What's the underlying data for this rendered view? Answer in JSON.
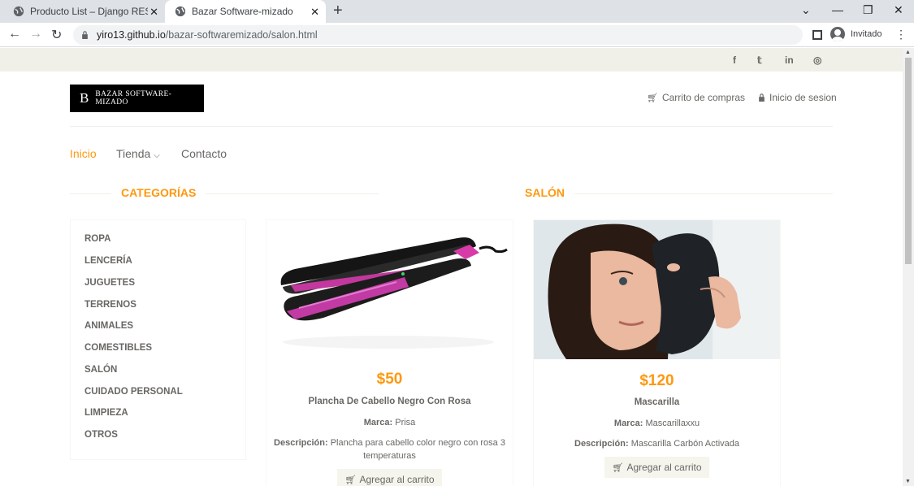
{
  "browser": {
    "tabs": [
      {
        "title": "Producto List – Django REST fran",
        "close": "✕"
      },
      {
        "title": "Bazar Software-mizado",
        "close": "✕"
      }
    ],
    "new_tab": "+",
    "url_host": "yiro13.github.io",
    "url_path": "/bazar-softwaremizado/salon.html",
    "profile": "Invitado",
    "window_controls": {
      "minimize": "—",
      "restore": "❐",
      "close": "✕",
      "tablist": "⌄"
    }
  },
  "social": [
    "f",
    "𝕥",
    "in",
    "◎"
  ],
  "logo": {
    "mark": "B",
    "text": "BAZAR SOFTWARE-MIZADO"
  },
  "header": {
    "cart": "Carrito de compras",
    "login": "Inicio de sesion"
  },
  "nav": {
    "home": "Inicio",
    "shop": "Tienda",
    "contact": "Contacto"
  },
  "sections": {
    "categories": "CATEGORÍAS",
    "salon": "SALÓN"
  },
  "categories": [
    "ROPA",
    "LENCERÍA",
    "JUGUETES",
    "TERRENOS",
    "ANIMALES",
    "COMESTIBLES",
    "SALÓN",
    "CUIDADO PERSONAL",
    "LIMPIEZA",
    "OTROS"
  ],
  "products": [
    {
      "price": "$50",
      "name": "Plancha De Cabello Negro Con Rosa",
      "brand_label": "Marca:",
      "brand": "Prisa",
      "desc_label": "Descripción:",
      "desc": "Plancha para cabello color negro con rosa 3 temperaturas",
      "button": "Agregar al carrito"
    },
    {
      "price": "$120",
      "name": "Mascarilla",
      "brand_label": "Marca:",
      "brand": "Mascarillaxxu",
      "desc_label": "Descripción:",
      "desc": "Mascarilla Carbón Activada",
      "button": "Agregar al carrito"
    }
  ],
  "colors": {
    "accent": "#fe980f",
    "text": "#696763",
    "strip": "#f0f0e9"
  }
}
